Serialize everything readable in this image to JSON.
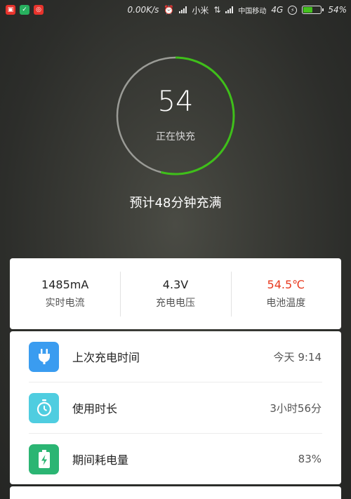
{
  "status_bar": {
    "speed": "0.00K/s",
    "carrier1": "小米",
    "carrier2": "中国移动",
    "network": "4G",
    "battery_pct": "54%",
    "battery_level": 0.54,
    "app_icon_colors": [
      "#e8332c",
      "#27b05e",
      "#e8332c"
    ]
  },
  "ring": {
    "value": "54",
    "progress": 0.54,
    "status": "正在快充",
    "color_progress": "#3fbf1a",
    "color_track": "#9a9b96"
  },
  "eta": "预计48分钟充满",
  "stats": [
    {
      "value": "1485mA",
      "label": "实时电流"
    },
    {
      "value": "4.3V",
      "label": "充电电压"
    },
    {
      "value": "54.5℃",
      "label": "电池温度",
      "color": "#e8391e"
    }
  ],
  "list": [
    {
      "label": "上次充电时间",
      "value": "今天 9:14",
      "icon": "plug-icon",
      "color": "#3a9cf0"
    },
    {
      "label": "使用时长",
      "value": "3小时56分",
      "icon": "stopwatch-icon",
      "color": "#4fcde0"
    },
    {
      "label": "期间耗电量",
      "value": "83%",
      "icon": "battery-charging-icon",
      "color": "#2bb573"
    }
  ]
}
